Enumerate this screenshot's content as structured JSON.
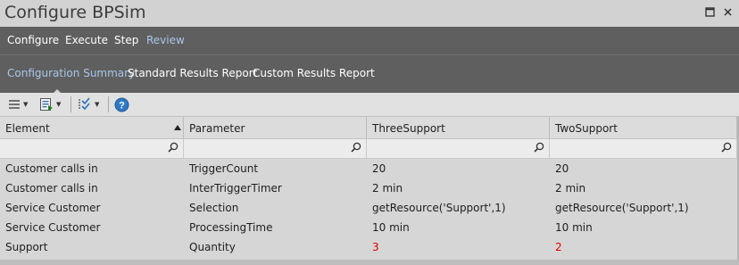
{
  "window": {
    "title": "Configure BPSim"
  },
  "menu": {
    "items": [
      {
        "label": "Configure",
        "active": false
      },
      {
        "label": "Execute",
        "active": false
      },
      {
        "label": "Step",
        "active": false
      },
      {
        "label": "Review",
        "active": true
      }
    ]
  },
  "subtabs": {
    "items": [
      {
        "label": "Configuration Summary",
        "active": true
      },
      {
        "label": "Standard Results Report",
        "active": false
      },
      {
        "label": "Custom Results Report",
        "active": false
      }
    ]
  },
  "toolbar": {
    "icons": [
      "menu-icon",
      "export-icon",
      "column-filter-icon",
      "help-icon"
    ]
  },
  "table": {
    "columns": [
      "Element",
      "Parameter",
      "ThreeSupport",
      "TwoSupport"
    ],
    "sorted_column": "Element",
    "rows": [
      [
        "Customer calls in",
        "TriggerCount",
        "20",
        "20"
      ],
      [
        "Customer calls in",
        "InterTriggerTimer",
        "2 min",
        "2 min"
      ],
      [
        "Service Customer",
        "Selection",
        "getResource('Support',1)",
        "getResource('Support',1)"
      ],
      [
        "Service Customer",
        "ProcessingTime",
        "10 min",
        "10 min"
      ],
      [
        "Support",
        "Quantity",
        "3",
        "2"
      ]
    ],
    "highlight_color": "#e00000"
  }
}
